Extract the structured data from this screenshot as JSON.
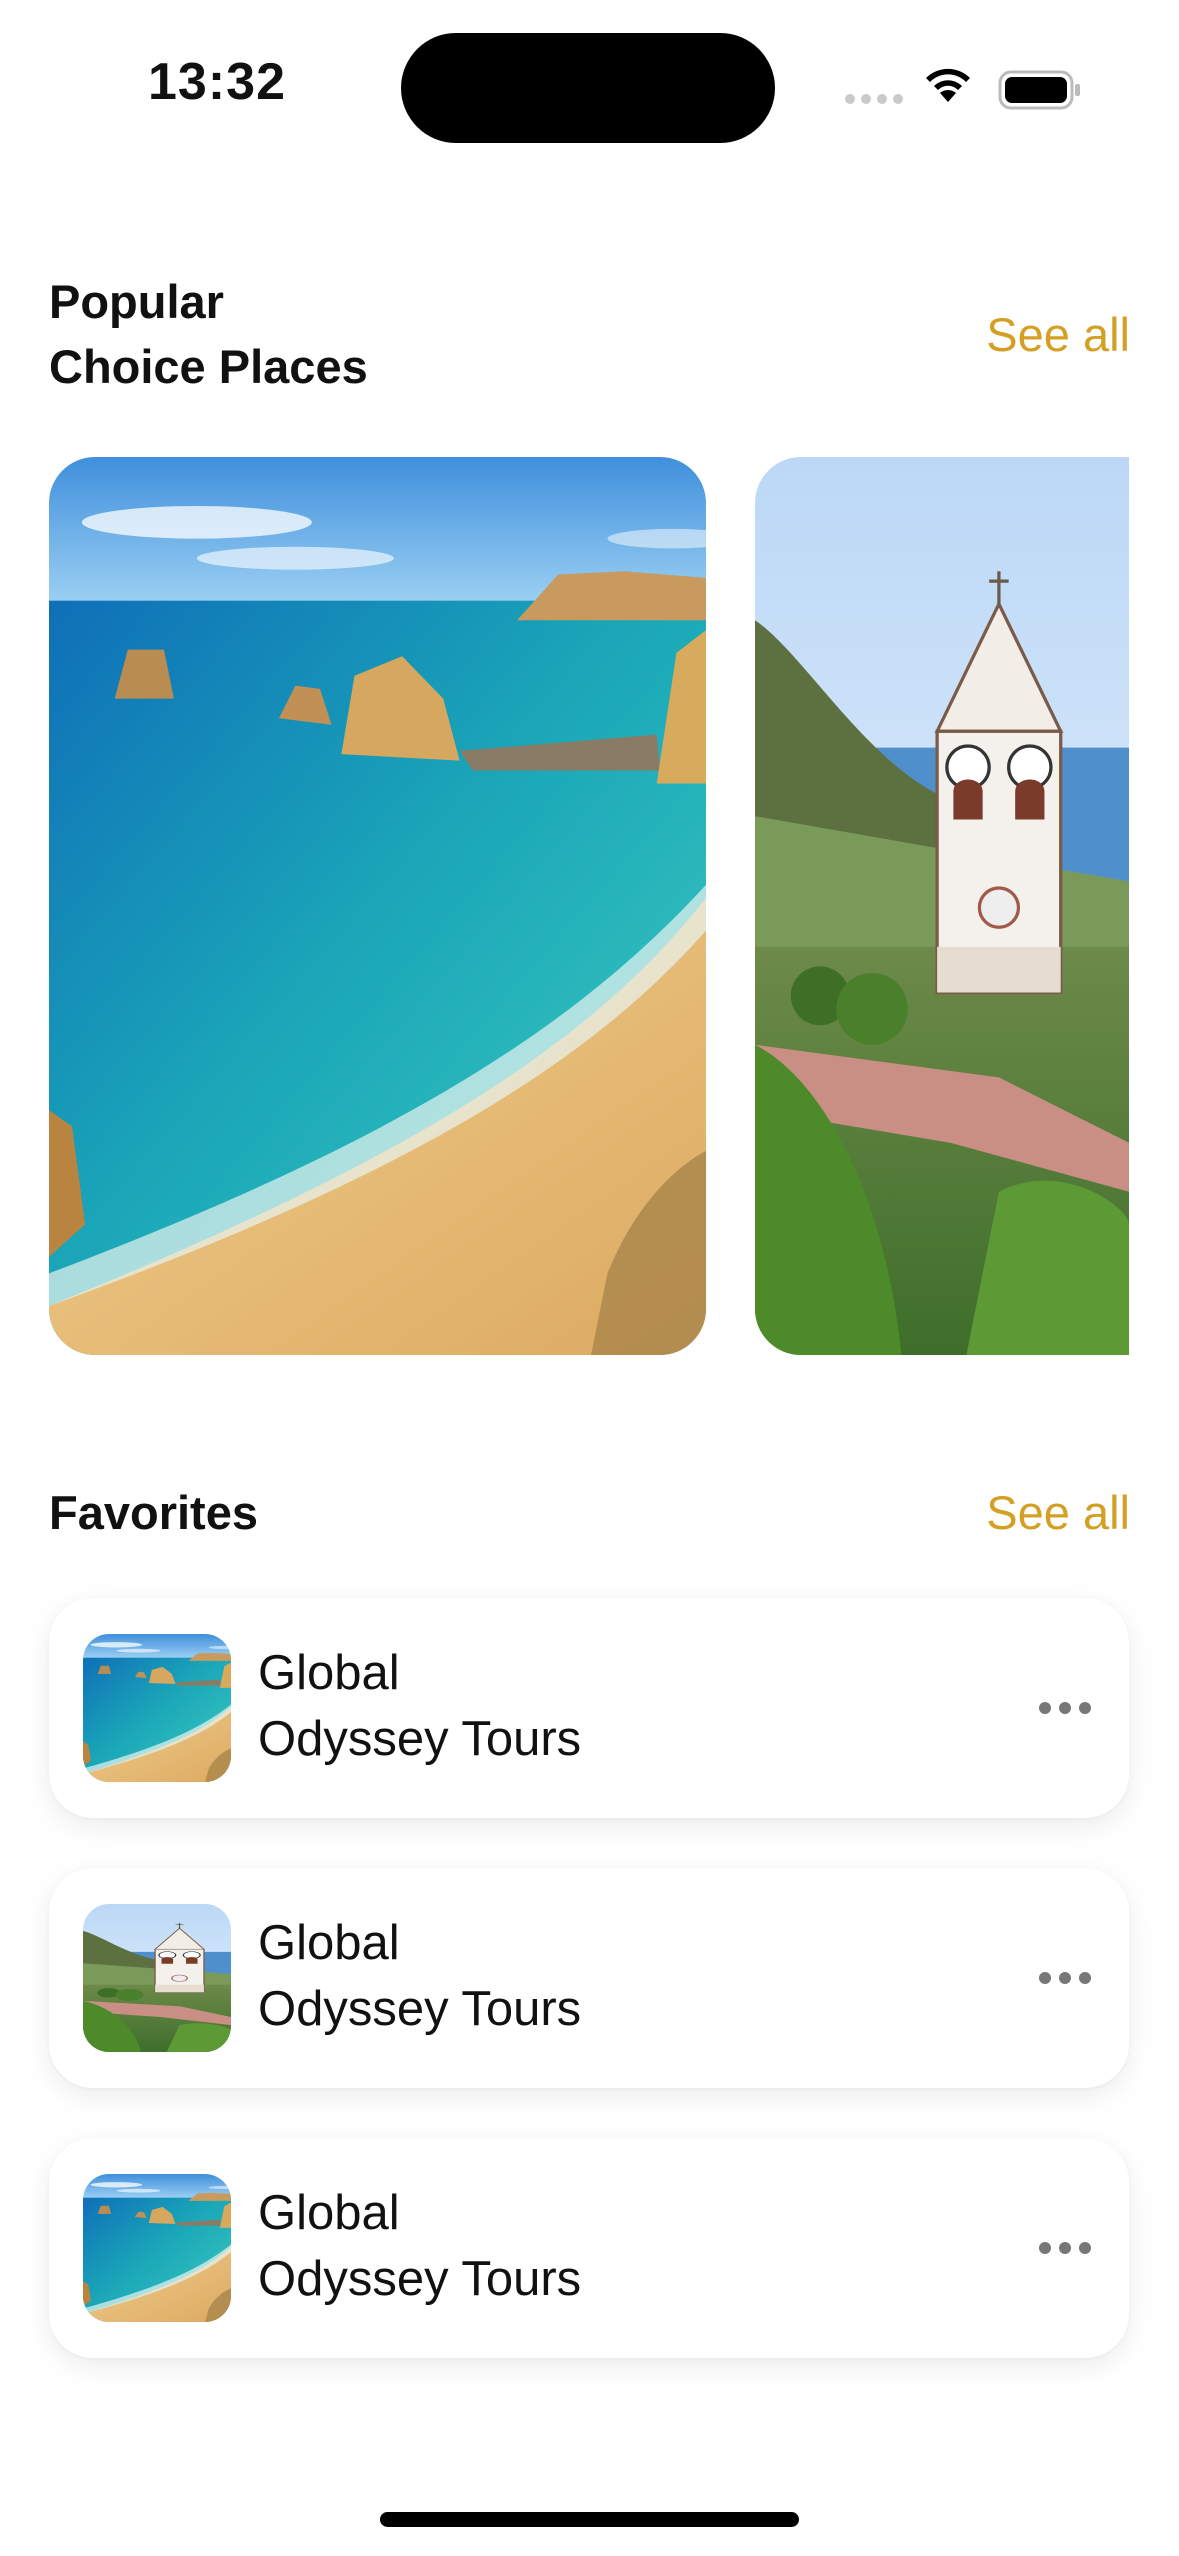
{
  "status_bar": {
    "time": "13:32"
  },
  "popular": {
    "title_line1": "Popular",
    "title_line2": "Choice Places",
    "see_all": "See all",
    "cards": [
      {
        "image": "beach-cove-photo"
      },
      {
        "image": "clock-tower-photo"
      }
    ]
  },
  "favorites": {
    "title": "Favorites",
    "see_all": "See all",
    "items": [
      {
        "line1": "Global",
        "line2": "Odyssey Tours",
        "thumb": "beach-cove-photo"
      },
      {
        "line1": "Global",
        "line2": "Odyssey Tours",
        "thumb": "clock-tower-photo"
      },
      {
        "line1": "Global",
        "line2": "Odyssey Tours",
        "thumb": "beach-cove-photo"
      }
    ]
  },
  "colors": {
    "accent": "#d4a024",
    "text": "#111111",
    "background": "#ffffff"
  }
}
